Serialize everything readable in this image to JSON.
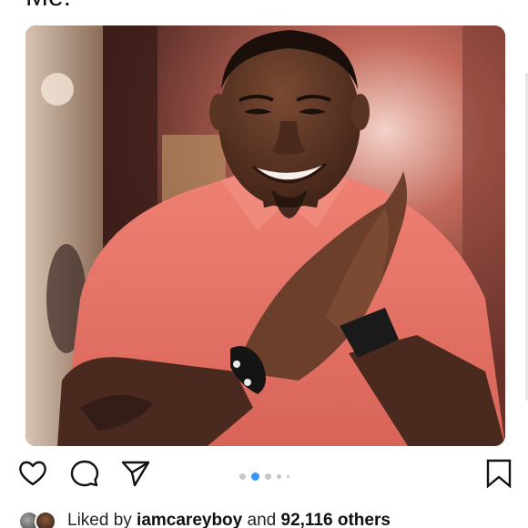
{
  "post": {
    "caption_fragment": "Me:",
    "image_alt_semantic": "man-clapping-smiling-photo",
    "carousel": {
      "total": 5,
      "active_index": 1
    }
  },
  "actions": {
    "like_icon": "heart-icon",
    "comment_icon": "comment-bubble-icon",
    "share_icon": "paper-plane-icon",
    "save_icon": "bookmark-icon"
  },
  "likes": {
    "prefix": "Liked by ",
    "user": "iamcareyboy",
    "middle": " and ",
    "others": "92,116 others"
  },
  "colors": {
    "accent_blue": "#3897f0",
    "inactive_dot": "#c7c7c7",
    "shirt_coral": "#e8746a"
  }
}
